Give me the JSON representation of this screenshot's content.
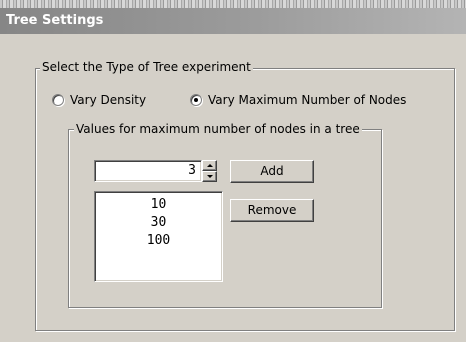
{
  "window": {
    "title": "Tree Settings"
  },
  "experiment_group": {
    "legend": "Select the Type of Tree experiment",
    "options": [
      {
        "label": "Vary Density",
        "selected": false
      },
      {
        "label": "Vary Maximum Number of Nodes",
        "selected": true
      }
    ]
  },
  "nodes_group": {
    "legend": "Values for maximum number of nodes in a tree",
    "input_value": "3",
    "add_label": "Add",
    "remove_label": "Remove",
    "list_items": [
      "10",
      "30",
      "100"
    ]
  }
}
